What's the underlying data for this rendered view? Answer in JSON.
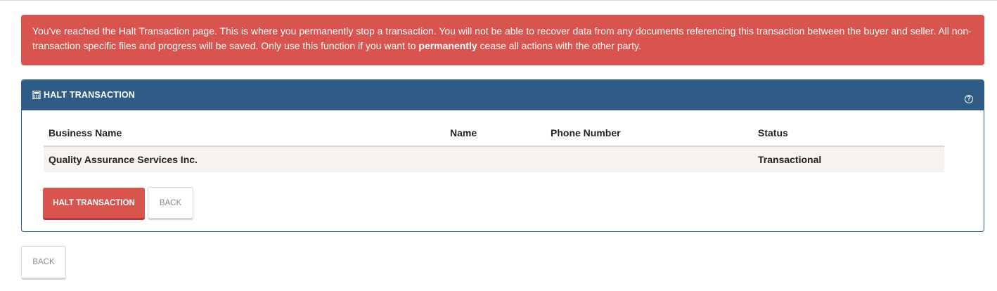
{
  "alert": {
    "text_before": "You've reached the Halt Transaction page. This is where you permanently stop a transaction. You will not be able to recover data from any documents referencing this transaction between the buyer and seller. All non-transaction specific files and progress will be saved. Only use this function if you want to ",
    "emphasis": "permanently",
    "text_after": " cease all actions with the other party."
  },
  "panel": {
    "title": "HALT TRANSACTION",
    "title_icon": "calculator-icon",
    "help_icon": "question-circle-icon",
    "header_color": "#2f5c87"
  },
  "table": {
    "headers": [
      "Business Name",
      "Name",
      "Phone Number",
      "Status"
    ],
    "rows": [
      [
        "Quality Assurance Services Inc.",
        "",
        "",
        "Transactional"
      ]
    ]
  },
  "buttons": {
    "halt_label": "HALT TRANSACTION",
    "back_inner_label": "BACK",
    "back_outer_label": "BACK"
  },
  "colors": {
    "danger": "#d9534f",
    "primary": "#2f5c87"
  }
}
